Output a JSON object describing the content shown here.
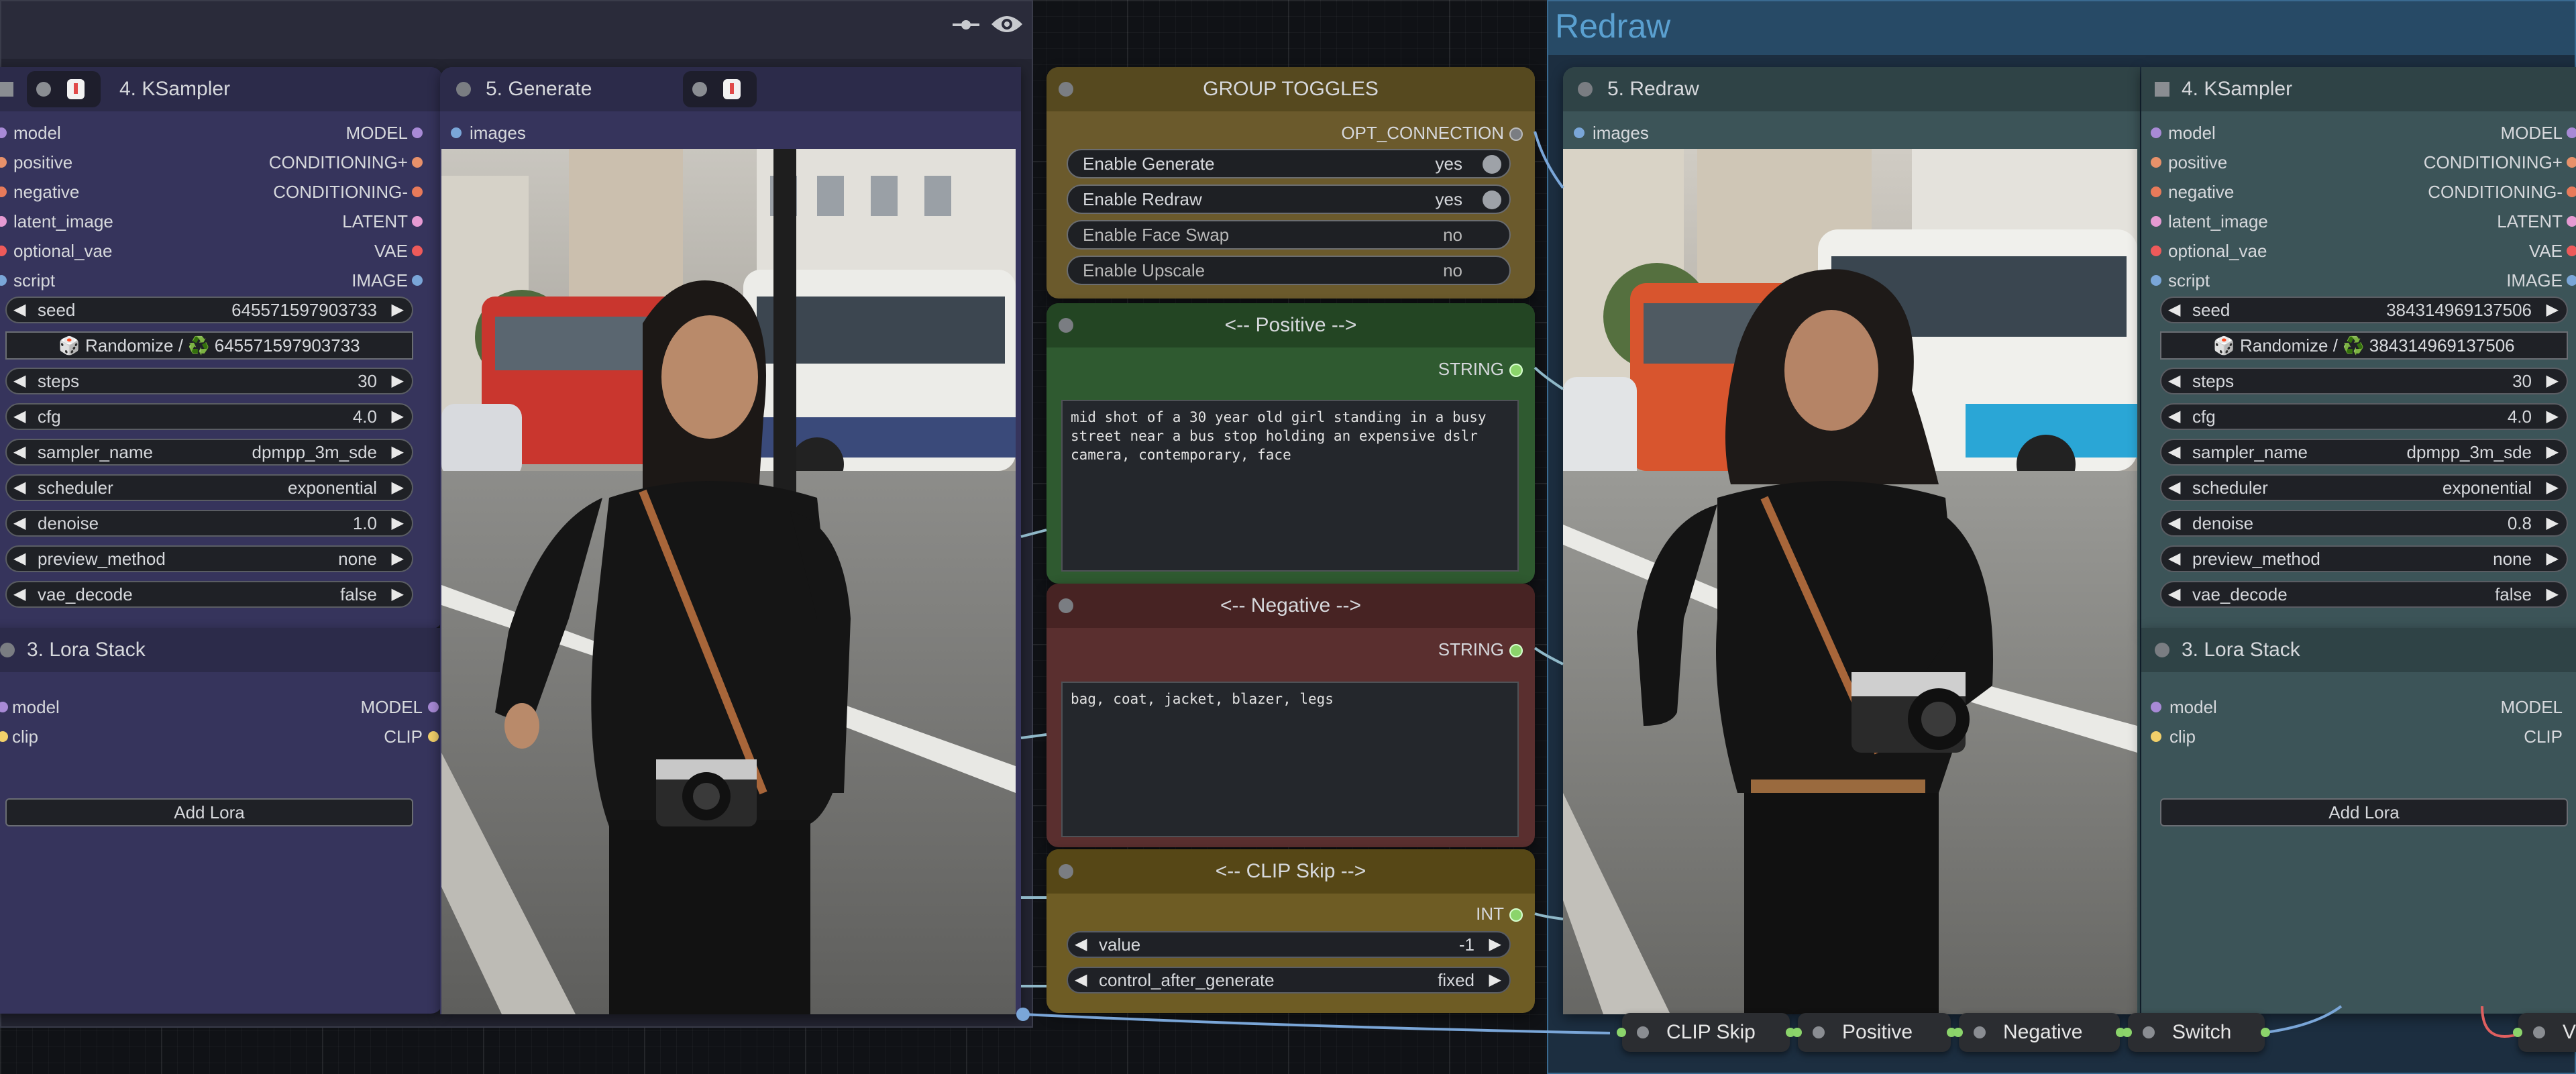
{
  "generate_panel": {
    "ksampler": {
      "title": "4. KSampler",
      "inputs": [
        {
          "label": "model",
          "type": "MODEL",
          "color": "#a88ad6"
        },
        {
          "label": "positive",
          "type": "CONDITIONING+",
          "color": "#e8916a"
        },
        {
          "label": "negative",
          "type": "CONDITIONING-",
          "color": "#e87a5a"
        },
        {
          "label": "latent_image",
          "type": "LATENT",
          "color": "#e69ad2"
        },
        {
          "label": "optional_vae",
          "type": "VAE",
          "color": "#ee5a5a"
        },
        {
          "label": "script",
          "type": "IMAGE",
          "color": "#7aa6d8"
        }
      ],
      "seed_label": "seed",
      "seed_value": "645571597903733",
      "randomize": "🎲 Randomize / ♻️ 645571597903733",
      "steps_label": "steps",
      "steps": "30",
      "cfg_label": "cfg",
      "cfg": "4.0",
      "sampler_label": "sampler_name",
      "sampler": "dpmpp_3m_sde",
      "scheduler_label": "scheduler",
      "scheduler": "exponential",
      "denoise_label": "denoise",
      "denoise": "1.0",
      "preview_label": "preview_method",
      "preview": "none",
      "vae_decode_label": "vae_decode",
      "vae_decode": "false"
    },
    "lora": {
      "title": "3. Lora Stack",
      "model_label": "model",
      "model_type": "MODEL",
      "clip_label": "clip",
      "clip_type": "CLIP",
      "add_lora": "Add Lora"
    },
    "generate": {
      "title": "5. Generate",
      "images_label": "images"
    }
  },
  "group_toggles": {
    "title": "GROUP TOGGLES",
    "output": "OPT_CONNECTION",
    "toggles": [
      {
        "label": "Enable Generate",
        "value": "yes"
      },
      {
        "label": "Enable Redraw",
        "value": "yes"
      },
      {
        "label": "Enable Face Swap",
        "value": "no"
      },
      {
        "label": "Enable Upscale",
        "value": "no"
      }
    ]
  },
  "positive": {
    "title": "<--  Positive  -->",
    "output": "STRING",
    "text": "mid shot of a 30 year old girl standing in a busy street near a bus stop holding an expensive dslr camera, contemporary, face"
  },
  "negative": {
    "title": "<--  Negative  -->",
    "output": "STRING",
    "text": "bag, coat, jacket, blazer, legs"
  },
  "clip_skip": {
    "title": "<--  CLIP Skip  -->",
    "output": "INT",
    "value_label": "value",
    "value": "-1",
    "control_label": "control_after_generate",
    "control": "fixed"
  },
  "redraw_panel": {
    "group_title": "Redraw",
    "redraw": {
      "title": "5. Redraw",
      "images_label": "images"
    },
    "ksampler": {
      "title": "4. KSampler",
      "inputs": [
        {
          "label": "model",
          "type": "MODEL",
          "color": "#a88ad6"
        },
        {
          "label": "positive",
          "type": "CONDITIONING+",
          "color": "#e8916a"
        },
        {
          "label": "negative",
          "type": "CONDITIONING-",
          "color": "#e87a5a"
        },
        {
          "label": "latent_image",
          "type": "LATENT",
          "color": "#e69ad2"
        },
        {
          "label": "optional_vae",
          "type": "VAE",
          "color": "#ee5a5a"
        },
        {
          "label": "script",
          "type": "IMAGE",
          "color": "#7aa6d8"
        }
      ],
      "seed_label": "seed",
      "seed_value": "384314969137506",
      "randomize": "🎲 Randomize / ♻️ 384314969137506",
      "steps_label": "steps",
      "steps": "30",
      "cfg_label": "cfg",
      "cfg": "4.0",
      "sampler_label": "sampler_name",
      "sampler": "dpmpp_3m_sde",
      "scheduler_label": "scheduler",
      "scheduler": "exponential",
      "denoise_label": "denoise",
      "denoise": "0.8",
      "preview_label": "preview_method",
      "preview": "none",
      "vae_decode_label": "vae_decode",
      "vae_decode": "false"
    },
    "lora": {
      "title": "3. Lora Stack",
      "model_label": "model",
      "model_type": "MODEL",
      "clip_label": "clip",
      "clip_type": "CLIP",
      "add_lora": "Add Lora"
    }
  },
  "bottom_tabs": [
    "CLIP Skip",
    "Positive",
    "Negative",
    "Switch",
    "V"
  ],
  "icons": [
    "link-icon",
    "eye-icon",
    "dice-icon",
    "recycle-icon",
    "chevron-left-icon",
    "chevron-right-icon",
    "bookmark-icon"
  ],
  "colors": {
    "generate_bg": "#36345c",
    "generate_title": "#2c2b4a",
    "toggles_bg": "#6b5a2c",
    "positive_bg": "#2f5a30",
    "negative_bg": "#5a2f2f",
    "clipskip_bg": "#6e5c24",
    "redraw_bg": "#3c5458",
    "redraw_group": "#20344a",
    "accent_green": "#7ee07a"
  }
}
